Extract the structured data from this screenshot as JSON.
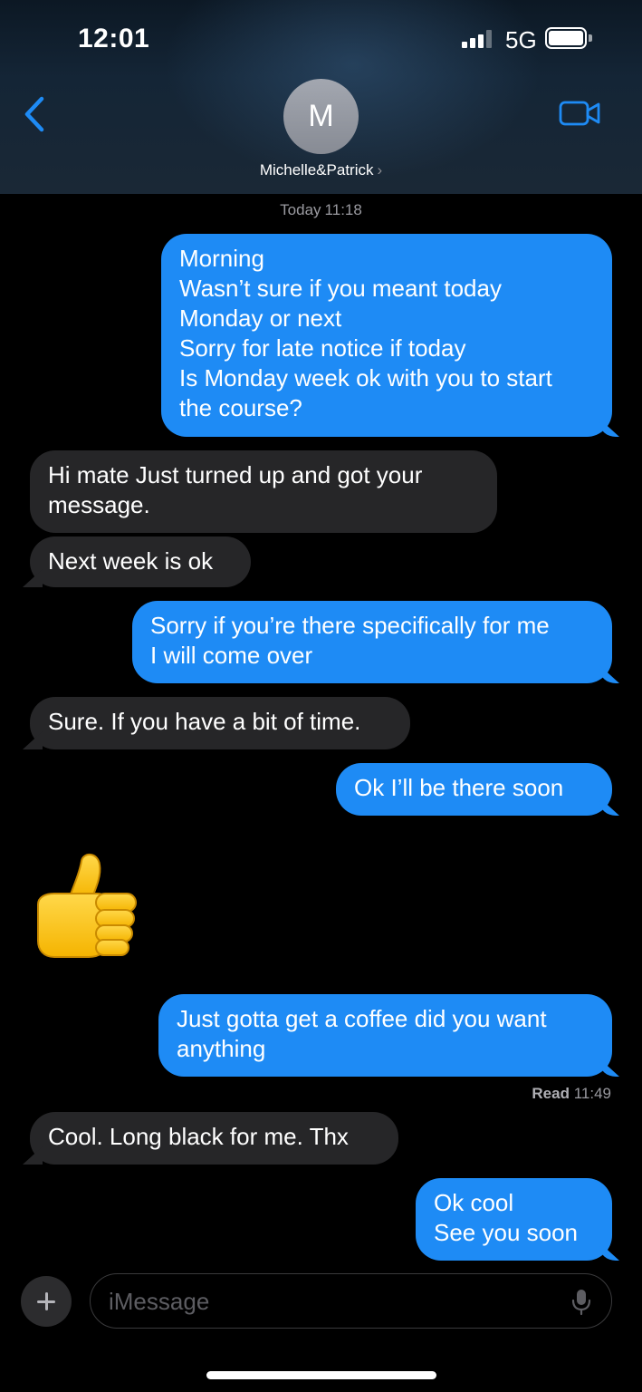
{
  "status_bar": {
    "time": "12:01",
    "network": "5G"
  },
  "header": {
    "avatar_initial": "M",
    "contact_name": "Michelle&Patrick",
    "chevron": "›"
  },
  "timestamp": {
    "day": "Today",
    "time": "11:18"
  },
  "messages": [
    {
      "from": "me",
      "text": "Morning\nWasn’t sure if you meant today\nMonday or next\nSorry for late notice if today\nIs Monday week ok with you to start\nthe course?"
    },
    {
      "from": "them",
      "text": "Hi mate   Just turned up and got your\nmessage."
    },
    {
      "from": "them",
      "text": "Next week is ok"
    },
    {
      "from": "me",
      "text": "Sorry if you’re there specifically for me\nI will come over"
    },
    {
      "from": "them",
      "text": "Sure. If you have a bit of time."
    },
    {
      "from": "me",
      "text": "Ok I’ll be there soon"
    },
    {
      "from": "them",
      "type": "emoji",
      "emoji": "thumbs-up-icon"
    },
    {
      "from": "me",
      "text": "Just gotta get a coffee did you want\nanything"
    },
    {
      "from": "them",
      "text": "Cool. Long black for me. Thx"
    },
    {
      "from": "me",
      "text": "Ok cool\nSee you soon"
    }
  ],
  "read_receipt": {
    "label": "Read",
    "time": "11:49"
  },
  "input": {
    "placeholder": "iMessage"
  },
  "icons": {
    "back": "chevron-left-icon",
    "video": "video-camera-icon",
    "add": "plus-icon",
    "mic": "microphone-icon"
  },
  "colors": {
    "sent_bubble": "#1e8bf5",
    "received_bubble": "#262628",
    "accent": "#1e8bf5",
    "background": "#000000"
  }
}
